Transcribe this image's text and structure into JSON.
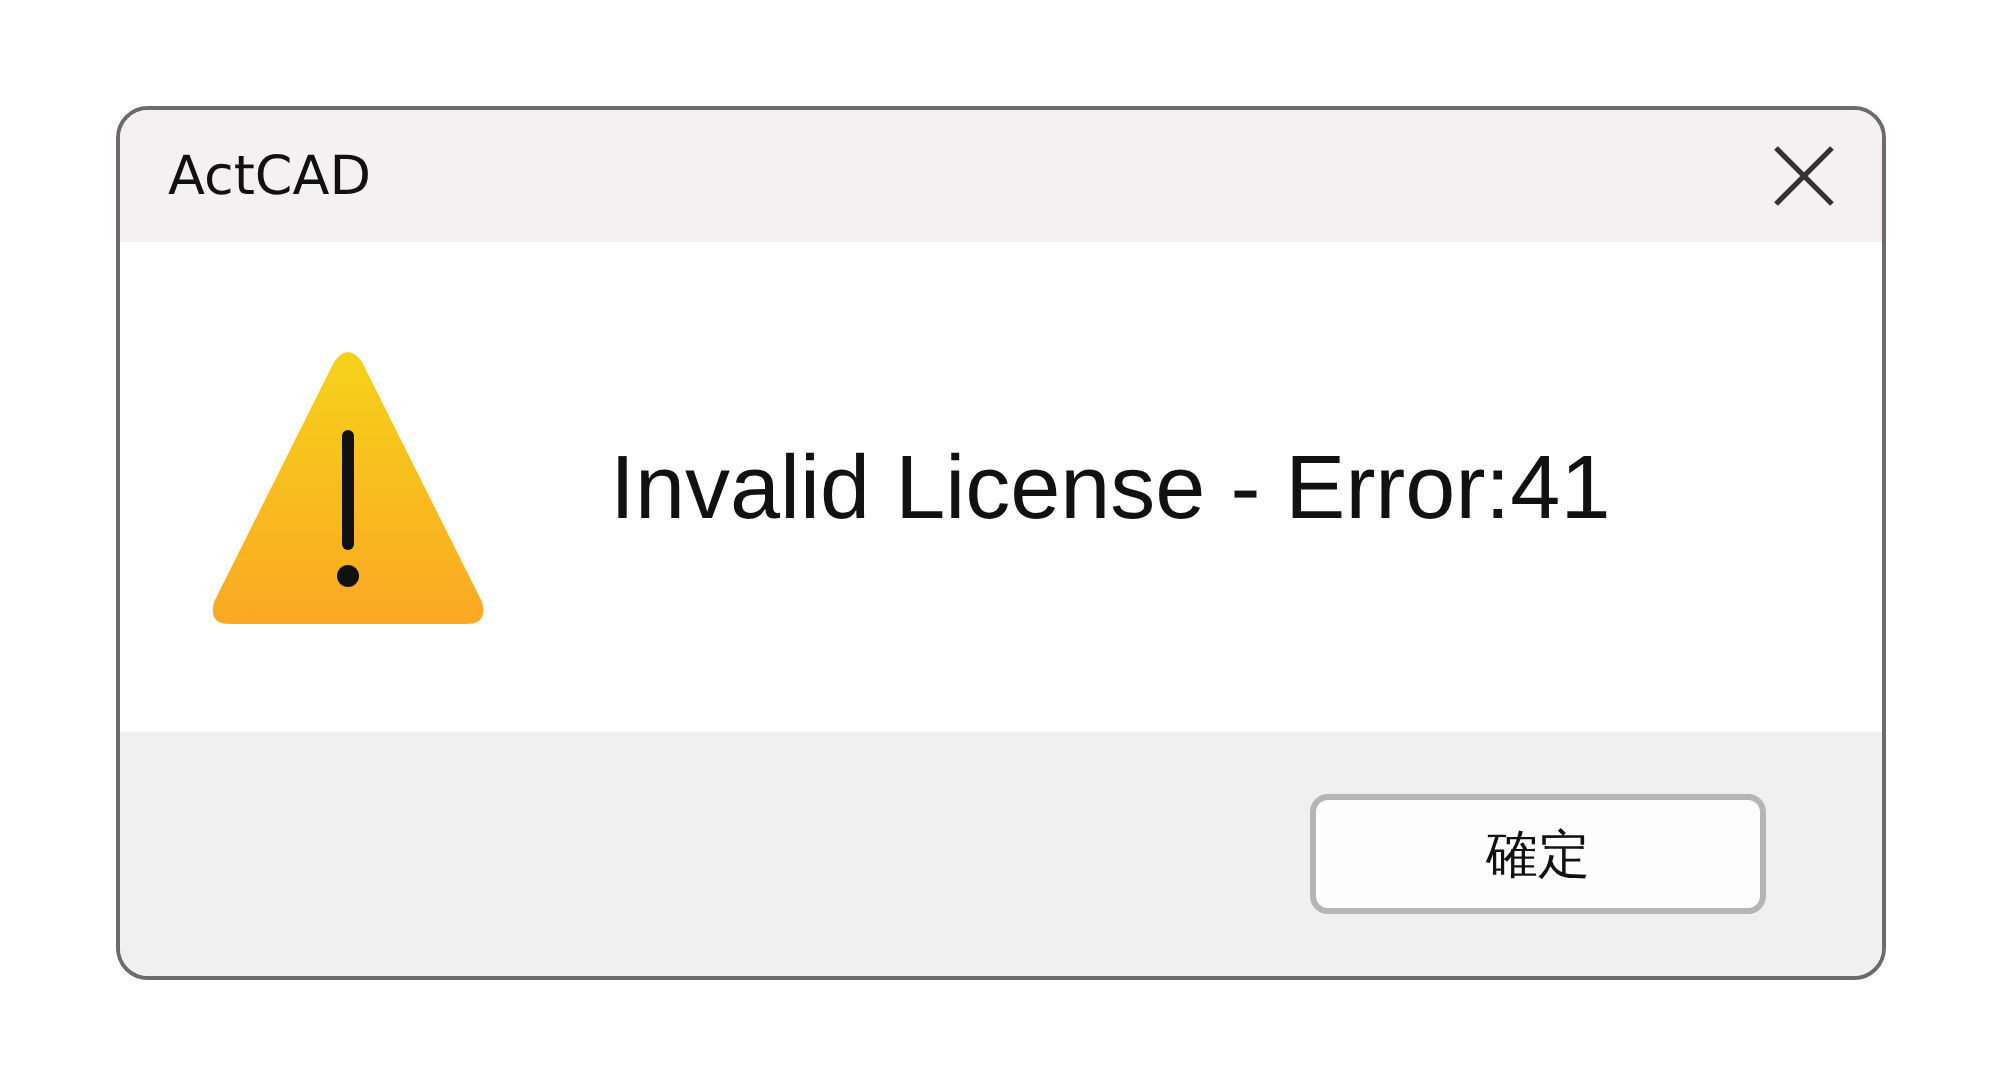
{
  "window": {
    "title": "ActCAD"
  },
  "message": "Invalid License - Error:41",
  "buttons": [
    "確定"
  ]
}
